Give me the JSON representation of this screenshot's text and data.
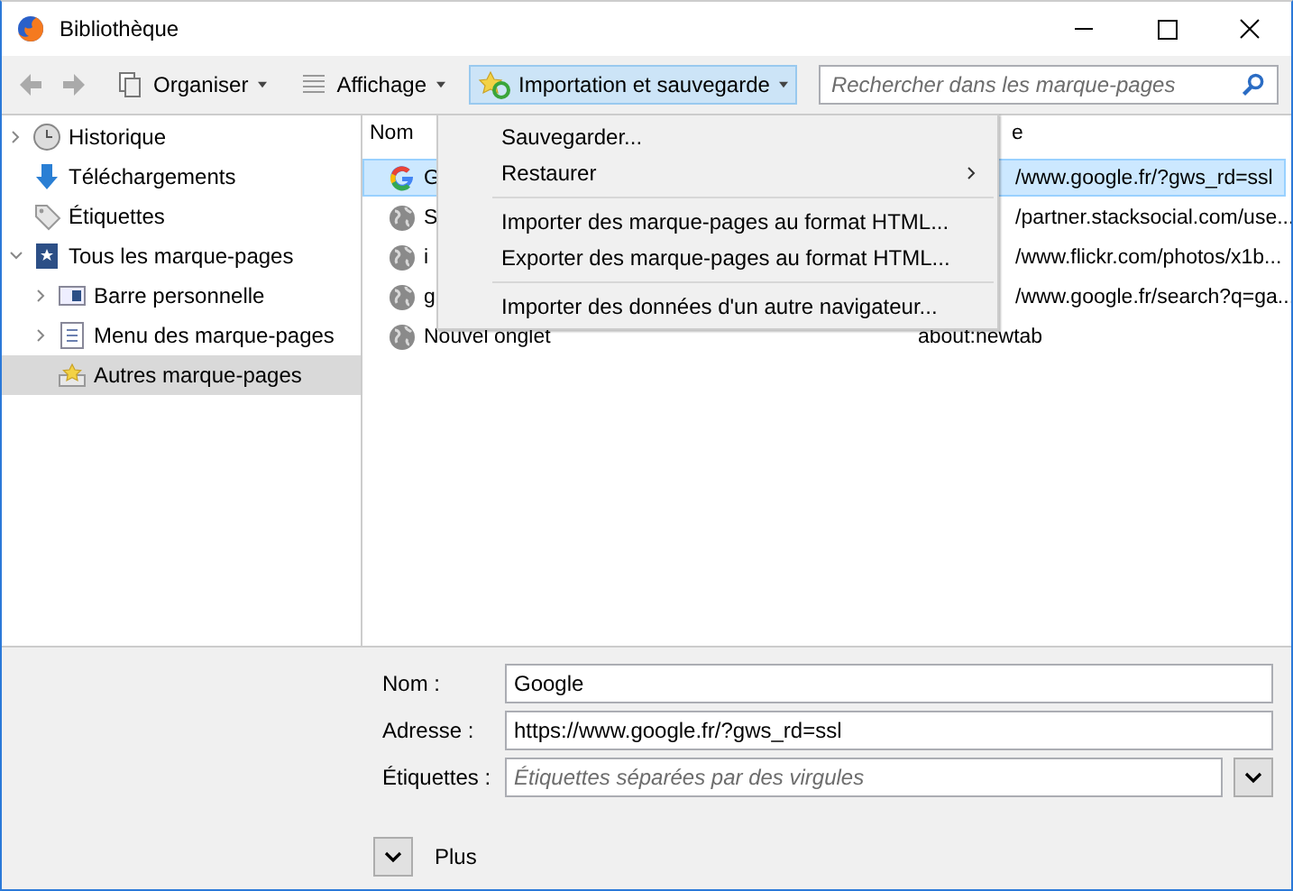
{
  "window": {
    "title": "Bibliothèque"
  },
  "toolbar": {
    "buttons": [
      {
        "label": "Organiser",
        "kind": "organize",
        "selected": false
      },
      {
        "label": "Affichage",
        "kind": "view",
        "selected": false
      },
      {
        "label": "Importation et sauvegarde",
        "kind": "import",
        "selected": true
      }
    ],
    "search": {
      "placeholder": "Rechercher dans les marque-pages"
    }
  },
  "sidebar": {
    "items": [
      {
        "label": "Historique",
        "kind": "history",
        "expanded": false,
        "selected": false
      },
      {
        "label": "Téléchargements",
        "kind": "downloads",
        "selected": false
      },
      {
        "label": "Étiquettes",
        "kind": "tags",
        "selected": false
      },
      {
        "label": "Tous les marque-pages",
        "kind": "all",
        "expanded": true,
        "selected": false,
        "children": [
          {
            "label": "Barre personnelle",
            "kind": "toolbar",
            "expanded": false,
            "selected": false
          },
          {
            "label": "Menu des marque-pages",
            "kind": "menu",
            "expanded": false,
            "selected": false
          },
          {
            "label": "Autres marque-pages",
            "kind": "other",
            "selected": true
          }
        ]
      }
    ]
  },
  "table": {
    "columns": [
      "Nom",
      "e"
    ],
    "rows": [
      {
        "name": "G",
        "address": "/www.google.fr/?gws_rd=ssl",
        "kind": "google",
        "selected": true,
        "covered": true
      },
      {
        "name": "S",
        "address": "/partner.stacksocial.com/use...",
        "kind": "globe",
        "selected": false,
        "covered": true
      },
      {
        "name": "i",
        "address": "/www.flickr.com/photos/x1b...",
        "kind": "globe",
        "selected": false,
        "covered": true
      },
      {
        "name": "g",
        "address": "/www.google.fr/search?q=ga...",
        "kind": "globe",
        "selected": false,
        "covered": true
      },
      {
        "name": "Nouvel onglet",
        "address": "about:newtab",
        "kind": "globe",
        "selected": false,
        "covered": false
      }
    ]
  },
  "menu": {
    "items": [
      {
        "kind": "item",
        "label": "Sauvegarder..."
      },
      {
        "kind": "submenu",
        "label": "Restaurer"
      },
      {
        "kind": "separator"
      },
      {
        "kind": "item",
        "label": "Importer des marque-pages au format HTML..."
      },
      {
        "kind": "item",
        "label": "Exporter des marque-pages au format HTML..."
      },
      {
        "kind": "separator"
      },
      {
        "kind": "item",
        "label": "Importer des données d'un autre navigateur..."
      }
    ]
  },
  "details": {
    "fields": [
      {
        "label": "Nom :",
        "kind": "text",
        "value": "Google"
      },
      {
        "label": "Adresse :",
        "kind": "text",
        "value": "https://www.google.fr/?gws_rd=ssl"
      },
      {
        "label": "Étiquettes :",
        "kind": "combo",
        "placeholder": "Étiquettes séparées par des virgules"
      }
    ],
    "more": "Plus"
  }
}
